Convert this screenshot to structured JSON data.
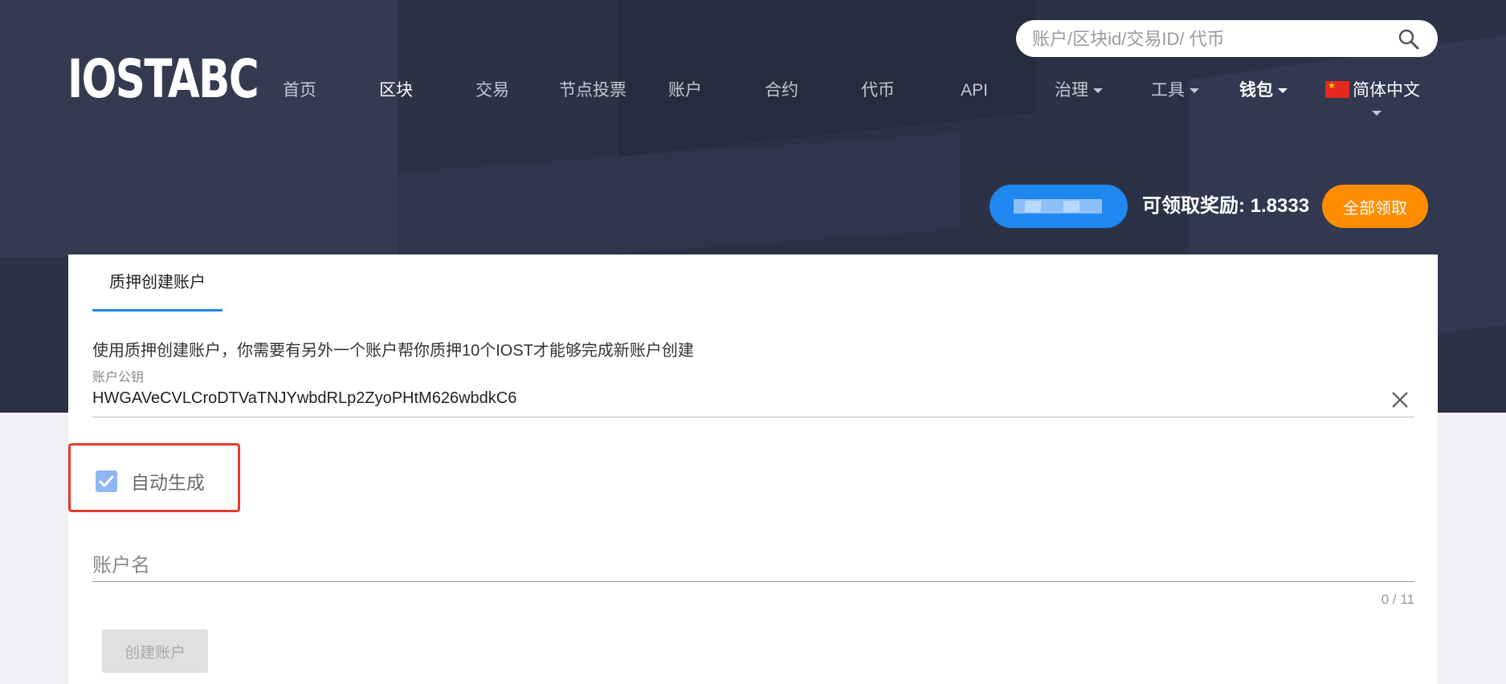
{
  "logo": "IOSTABC",
  "nav": {
    "home": "首页",
    "blocks": "区块",
    "transactions": "交易",
    "node_voting": "节点投票",
    "accounts": "账户",
    "contracts": "合约",
    "tokens": "代币",
    "api": "API",
    "governance": "治理",
    "tools": "工具",
    "wallet": "钱包",
    "language": "简体中文"
  },
  "search": {
    "placeholder": "账户/区块id/交易ID/ 代币"
  },
  "rewards": {
    "label": "可领取奖励: 1.8333",
    "claim_button": "全部领取"
  },
  "form": {
    "tab_label": "质押创建账户",
    "description": "使用质押创建账户，你需要有另外一个账户帮你质押10个IOST才能够完成新账户创建",
    "public_key_label": "账户公钥",
    "public_key_value": "HWGAVeCVLCroDTVaTNJYwbdRLp2ZyoPHtM626wbdkC6",
    "auto_generate_label": "自动生成",
    "auto_generate_checked": true,
    "account_name_placeholder": "账户名",
    "char_counter": "0 / 11",
    "create_button": "创建账户"
  },
  "colors": {
    "header_bg": "#2c3246",
    "accent_blue": "#1e88f0",
    "claim_orange": "#ff8c00",
    "highlight_red": "#e53a31"
  }
}
